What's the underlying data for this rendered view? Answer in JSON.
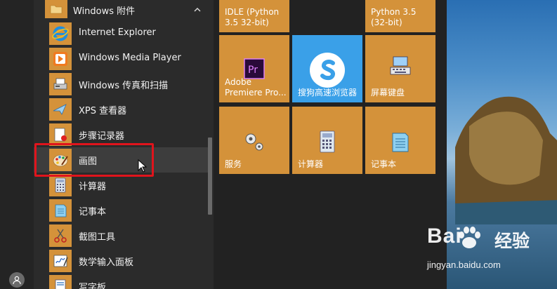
{
  "start_menu": {
    "group": {
      "label": "Windows 附件",
      "collapse_icon": "chevron-up-icon"
    },
    "apps": [
      {
        "label": "Internet Explorer",
        "icon": "internet-explorer-icon"
      },
      {
        "label": "Windows Media Player",
        "icon": "media-player-icon"
      },
      {
        "label": "Windows 传真和扫描",
        "icon": "fax-scanner-icon"
      },
      {
        "label": "XPS 查看器",
        "icon": "xps-viewer-icon"
      },
      {
        "label": "步骤记录器",
        "icon": "steps-recorder-icon"
      },
      {
        "label": "画图",
        "icon": "paint-icon"
      },
      {
        "label": "计算器",
        "icon": "calculator-icon"
      },
      {
        "label": "记事本",
        "icon": "notepad-icon"
      },
      {
        "label": "截图工具",
        "icon": "snipping-tool-icon"
      },
      {
        "label": "数学输入面板",
        "icon": "math-input-icon"
      },
      {
        "label": "写字板",
        "icon": "wordpad-icon"
      }
    ],
    "user_icon": "user-icon"
  },
  "tiles": [
    {
      "label": "IDLE (Python 3.5 32-bit)",
      "icon": "python-idle-icon"
    },
    {
      "label": "Python 3.5 (32-bit)",
      "icon": "python-icon"
    },
    {
      "label": "Adobe Premiere Pro...",
      "icon": "premiere-icon"
    },
    {
      "label": "搜狗高速浏览器",
      "icon": "sogou-browser-icon"
    },
    {
      "label": "屏幕键盘",
      "icon": "on-screen-keyboard-icon"
    },
    {
      "label": "服务",
      "icon": "services-icon"
    },
    {
      "label": "计算器",
      "icon": "calculator-icon"
    },
    {
      "label": "记事本",
      "icon": "notepad-icon"
    }
  ],
  "premiere_badge": "Pr",
  "watermark": {
    "brand": "Bai",
    "brand_cn": "经验",
    "url": "jingyan.baidu.com"
  },
  "colors": {
    "tile_orange": "#d4923a",
    "tile_blue": "#3aa0e8",
    "highlight_red": "#e0141c",
    "panel_bg": "#2b2b2b"
  }
}
